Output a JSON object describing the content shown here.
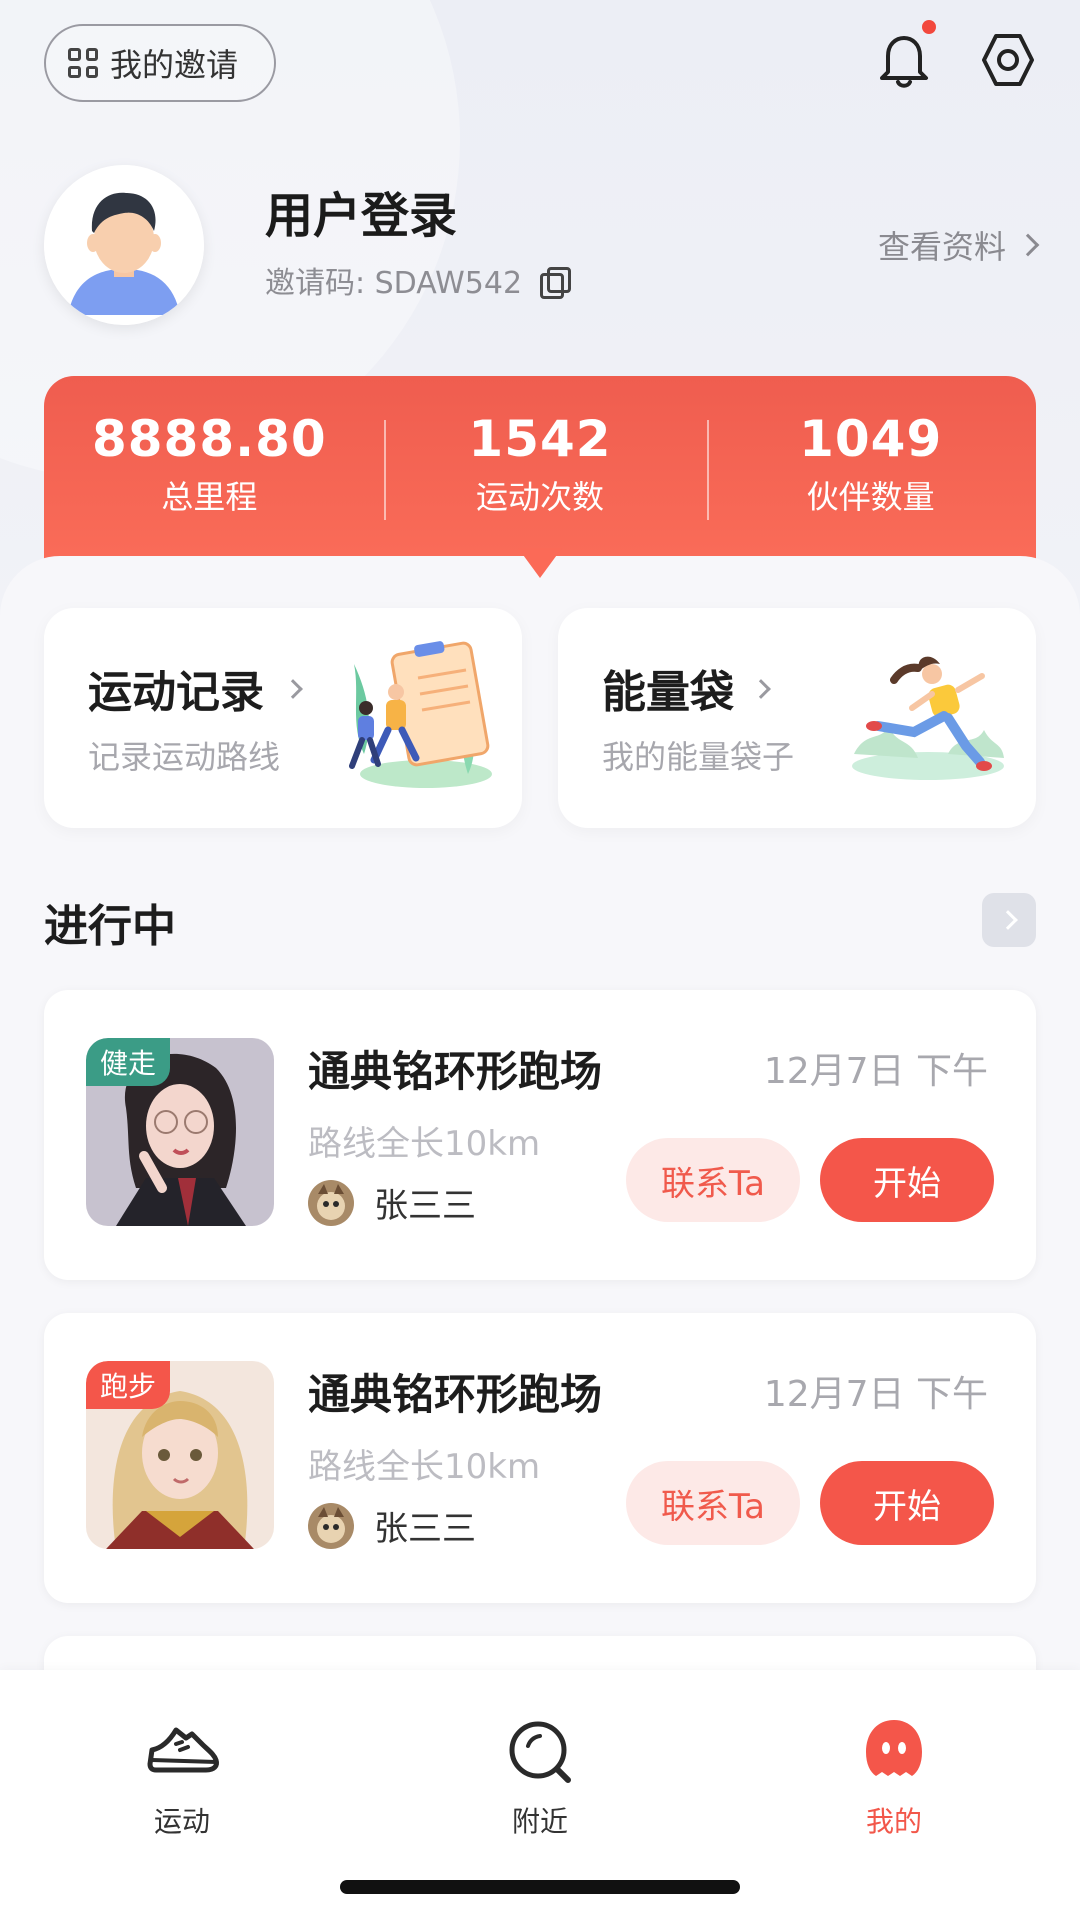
{
  "header": {
    "invite_label": "我的邀请",
    "notification_dot": true
  },
  "profile": {
    "name": "用户登录",
    "invite_code": "邀请码: SDAW542",
    "view_profile": "查看资料"
  },
  "stats": [
    {
      "value": "8888.80",
      "label": "总里程"
    },
    {
      "value": "1542",
      "label": "运动次数"
    },
    {
      "value": "1049",
      "label": "伙伴数量"
    }
  ],
  "features": [
    {
      "title": "运动记录",
      "subtitle": "记录运动路线"
    },
    {
      "title": "能量袋",
      "subtitle": "我的能量袋子"
    }
  ],
  "section": {
    "title": "进行中"
  },
  "routes": [
    {
      "tag": "健走",
      "tag_color": "#3b9c86",
      "name": "通典铭环形跑场",
      "time": "12月7日 下午",
      "length": "路线全长10km",
      "user": "张三三",
      "contact": "联系Ta",
      "start": "开始"
    },
    {
      "tag": "跑步",
      "tag_color": "#f4564a",
      "name": "通典铭环形跑场",
      "time": "12月7日 下午",
      "length": "路线全长10km",
      "user": "张三三",
      "contact": "联系Ta",
      "start": "开始"
    }
  ],
  "nav": [
    {
      "label": "运动",
      "icon": "shoe-icon"
    },
    {
      "label": "附近",
      "icon": "search-icon"
    },
    {
      "label": "我的",
      "icon": "ghost-icon",
      "active": true
    }
  ],
  "colors": {
    "accent": "#f4564a",
    "accent_light": "#fde9e7",
    "teal_tag": "#3b9c86"
  }
}
